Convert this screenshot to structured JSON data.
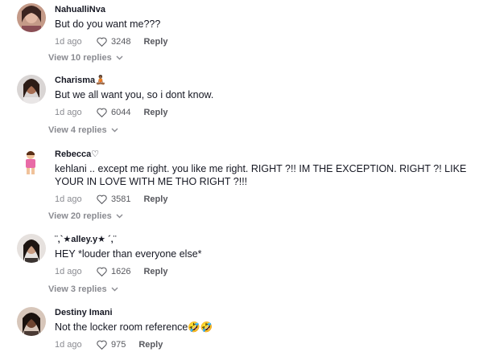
{
  "comments": [
    {
      "username": "NahualliNva",
      "text": "But do you want me???",
      "time": "1d ago",
      "likes": "3248",
      "reply": "Reply",
      "view_replies": "View 10 replies"
    },
    {
      "username": "Charisma🧘🏾",
      "text": "But we all want you, so i dont know.",
      "time": "1d ago",
      "likes": "6044",
      "reply": "Reply",
      "view_replies": "View 4 replies"
    },
    {
      "username": "Rebecca♡",
      "text": "kehlani .. except me right. you like me right. RIGHT ?!! IM THE EXCEPTION. RIGHT ?! LIKE YOUR IN LOVE WITH ME THO RIGHT ?!!!",
      "time": "1d ago",
      "likes": "3581",
      "reply": "Reply",
      "view_replies": "View 20 replies"
    },
    {
      "username": "¨‚`★alley.y★ ´‚¨",
      "text": "HEY *louder than everyone else*",
      "time": "1d ago",
      "likes": "1626",
      "reply": "Reply",
      "view_replies": "View 3 replies"
    },
    {
      "username": "Destiny Imani",
      "text": "Not the locker room reference🤣🤣",
      "time": "1d ago",
      "likes": "975",
      "reply": "Reply"
    }
  ],
  "colors": {
    "text": "#161823",
    "muted": "#8a8b91",
    "background": "#ffffff"
  },
  "icons": {
    "like": "heart-outline-icon",
    "expand": "chevron-down-icon"
  }
}
